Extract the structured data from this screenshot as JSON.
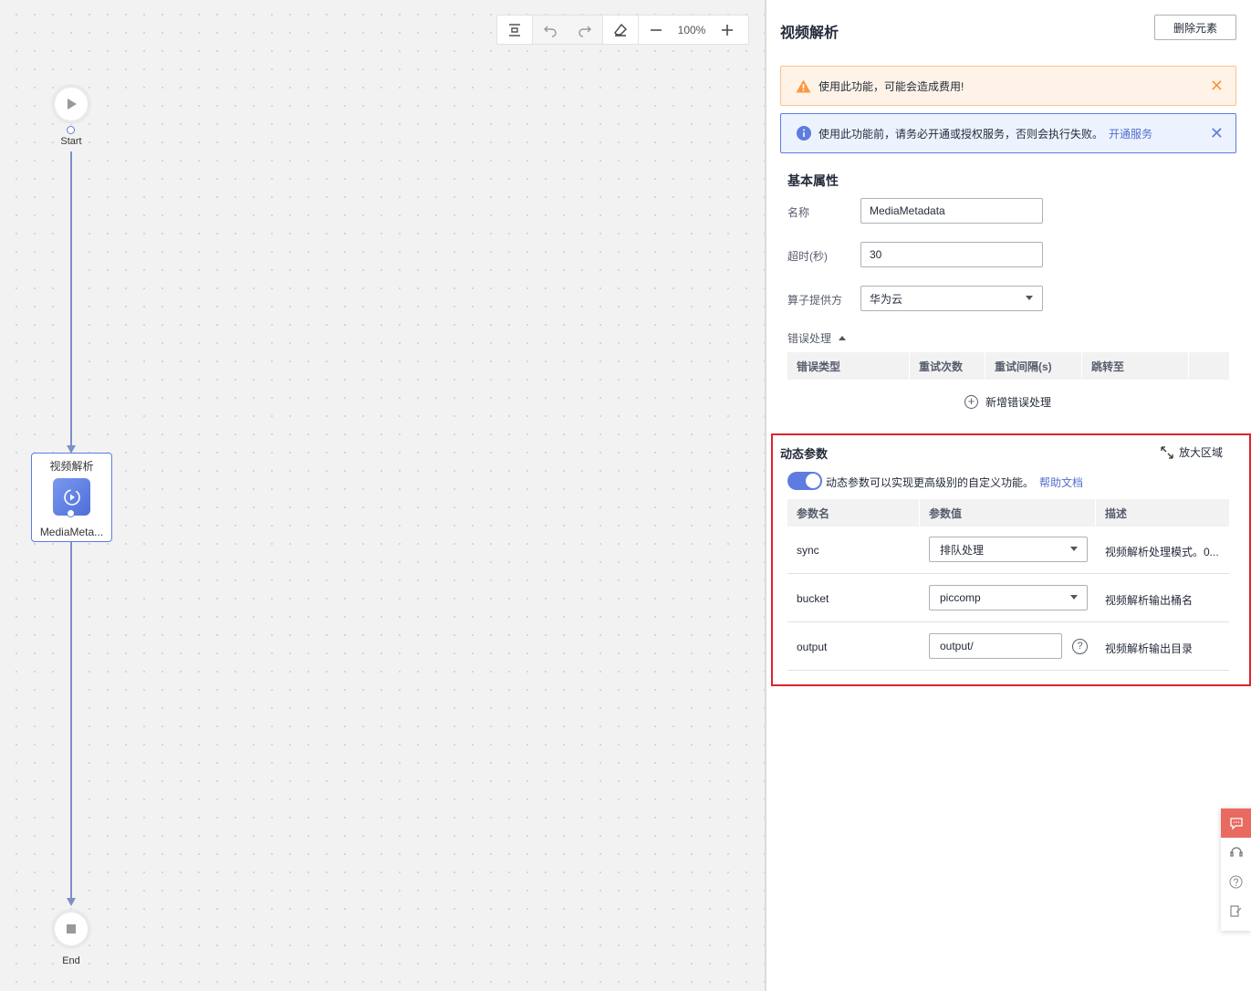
{
  "toolbar": {
    "zoom": "100%",
    "icons": [
      "fit-icon",
      "undo-icon",
      "redo-icon",
      "eraser-icon",
      "zoom-out-icon",
      "zoom-in-icon"
    ]
  },
  "flow": {
    "start_label": "Start",
    "end_label": "End",
    "task": {
      "title": "视频解析",
      "name": "MediaMeta..."
    }
  },
  "panel": {
    "title": "视频解析",
    "delete_label": "删除元素",
    "warning": {
      "text": "使用此功能，可能会造成费用!"
    },
    "info": {
      "text": "使用此功能前，请务必开通或授权服务，否则会执行失败。",
      "link": "开通服务"
    },
    "basic": {
      "title": "基本属性",
      "name_label": "名称",
      "name_value": "MediaMetadata",
      "timeout_label": "超时(秒)",
      "timeout_value": "30",
      "provider_label": "算子提供方",
      "provider_value": "华为云"
    },
    "error": {
      "toggle_label": "错误处理",
      "columns": [
        "错误类型",
        "重试次数",
        "重试间隔(s)",
        "跳转至"
      ],
      "add_label": "新增错误处理"
    },
    "dynamic": {
      "title": "动态参数",
      "expand_label": "放大区域",
      "enabled": true,
      "toggle_text": "动态参数可以实现更高级别的自定义功能。",
      "help_link": "帮助文档",
      "columns": [
        "参数名",
        "参数值",
        "描述"
      ],
      "rows": [
        {
          "name": "sync",
          "value": "排队处理",
          "desc": "视频解析处理模式。0..."
        },
        {
          "name": "bucket",
          "value": "piccomp",
          "desc": "视频解析输出桶名"
        },
        {
          "name": "output",
          "value": "output/",
          "desc": "视频解析输出目录"
        }
      ]
    }
  },
  "side_tools": [
    "chat-icon",
    "headset-icon",
    "help-icon",
    "edit-note-icon"
  ],
  "colors": {
    "accent": "#5e7ce0",
    "warning": "#fa9841",
    "highlight_border": "#e0232d"
  }
}
